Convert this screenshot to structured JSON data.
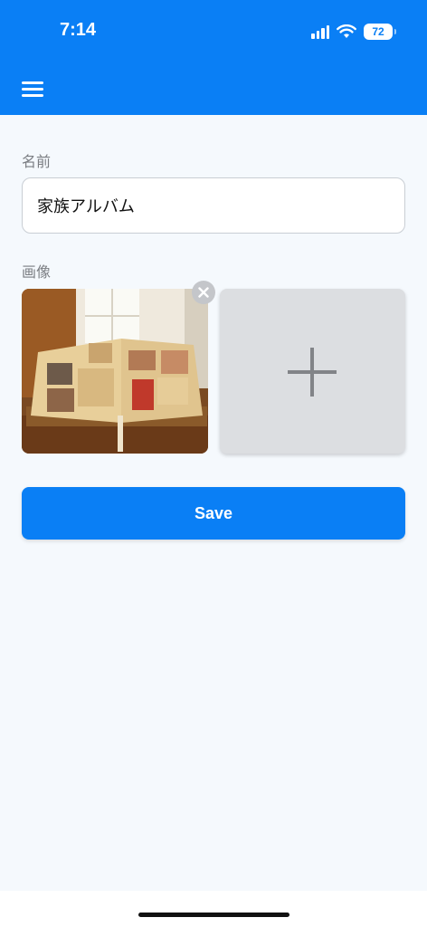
{
  "status_bar": {
    "time": "7:14",
    "battery": "72"
  },
  "header": {
    "menu_icon": "hamburger-menu-icon",
    "background_color": "#0a7ff5"
  },
  "form": {
    "name_label": "名前",
    "name_value": "家族アルバム",
    "image_label": "画像",
    "images": [
      {
        "alt": "家族アルバム"
      }
    ],
    "remove_icon": "close-icon",
    "add_icon": "plus-icon",
    "save_label": "Save"
  }
}
